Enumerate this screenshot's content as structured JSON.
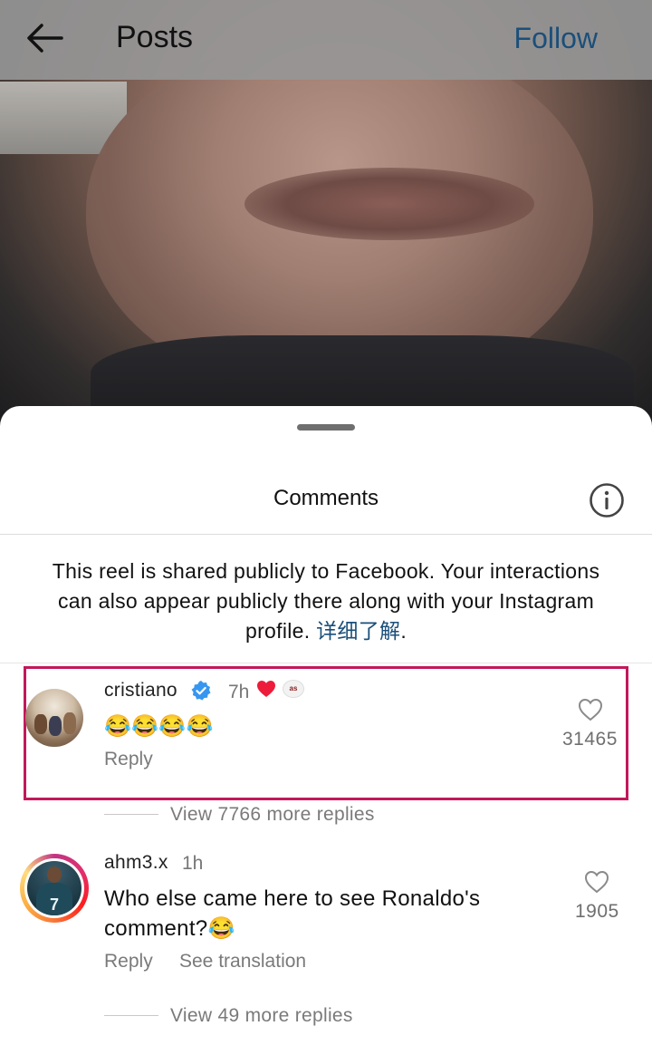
{
  "header": {
    "title": "Posts",
    "follow_label": "Follow"
  },
  "sheet": {
    "title": "Comments",
    "notice_text": "This reel is shared publicly to Facebook. Your interactions can also appear publicly there along with your Instagram profile. ",
    "notice_link": "详细了解",
    "notice_end": "."
  },
  "comments": [
    {
      "username": "cristiano",
      "verified": true,
      "time": "7h",
      "badge": "as",
      "text": "😂😂😂😂",
      "reply_label": "Reply",
      "likes": "31465",
      "view_replies": "View 7766 more replies"
    },
    {
      "username": "ahm3.x",
      "time": "1h",
      "text_line1": "Who else came here to see Ronaldo's",
      "text_line2": "comment?😂",
      "avatar_number": "7",
      "reply_label": "Reply",
      "translate_label": "See translation",
      "likes": "1905",
      "view_replies": "View 49 more replies"
    }
  ],
  "colors": {
    "link": "#1b4f7a",
    "highlight": "#c2185b",
    "verified": "#3797f0",
    "liked": "#ed1c3a"
  },
  "icons": {
    "back": "arrow-left-icon",
    "info": "info-circle-icon",
    "like": "heart-outline-icon",
    "verified": "verified-badge-icon",
    "author_liked": "red-heart-icon"
  }
}
